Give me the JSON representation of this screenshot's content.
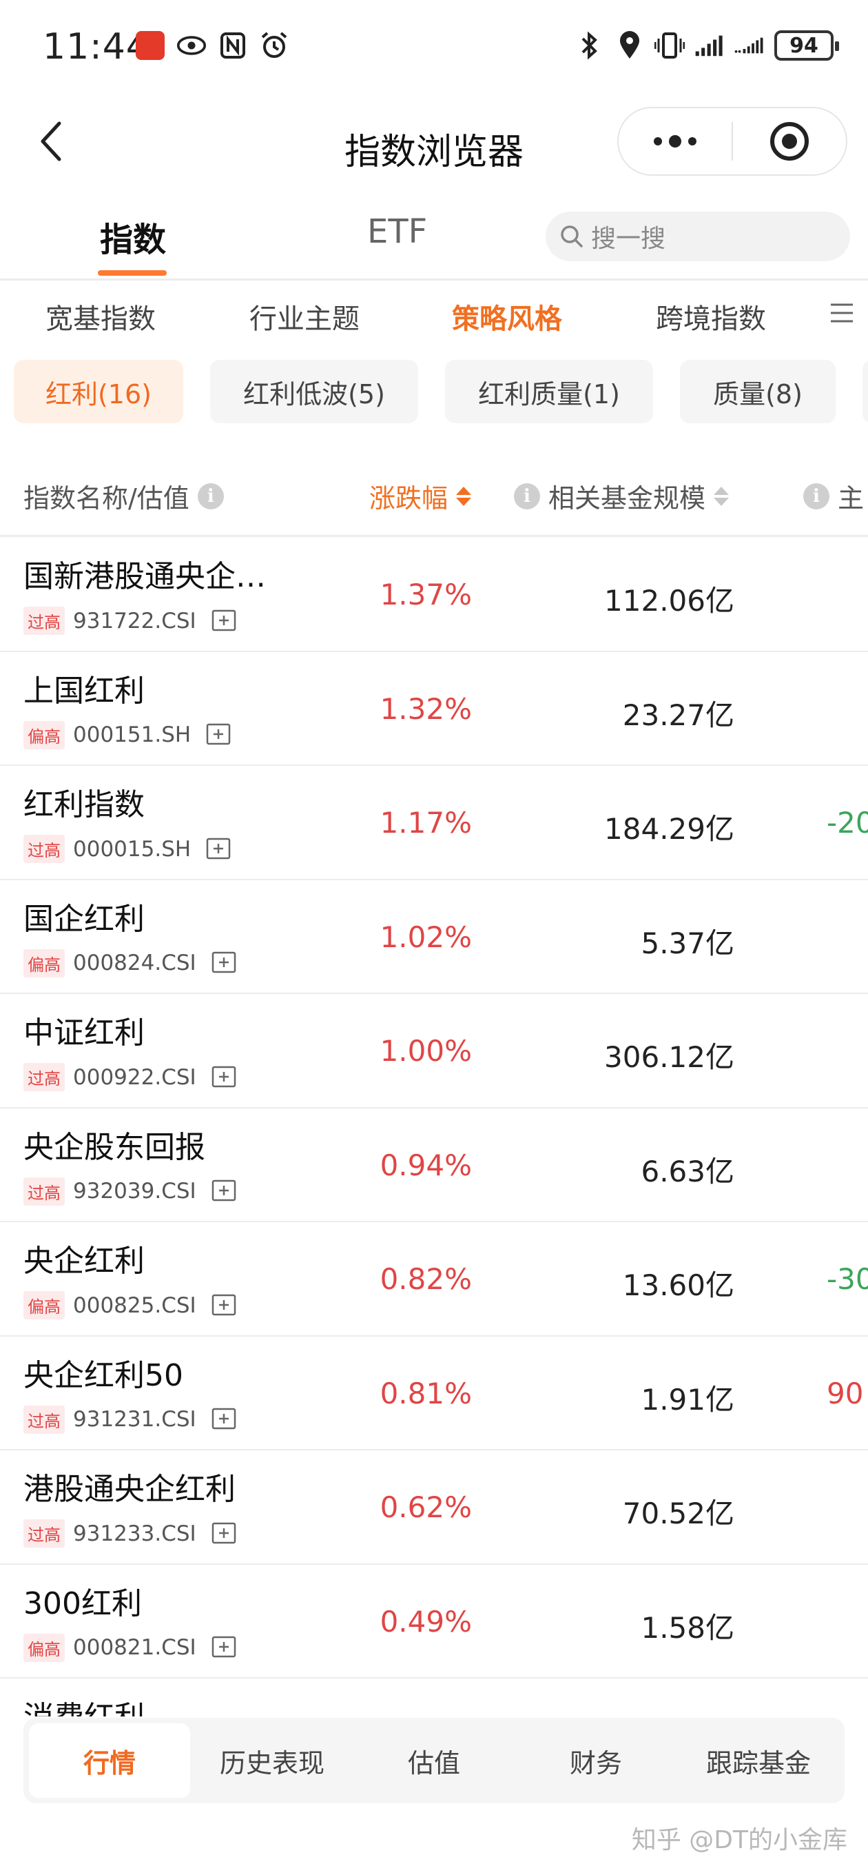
{
  "status_bar": {
    "time": "11:44",
    "battery": "94"
  },
  "title_bar": {
    "title": "指数浏览器"
  },
  "main_tabs": [
    {
      "label": "指数"
    },
    {
      "label": "ETF"
    }
  ],
  "search": {
    "placeholder": "搜一搜"
  },
  "category_tabs": [
    {
      "label": "宽基指数"
    },
    {
      "label": "行业主题"
    },
    {
      "label": "策略风格"
    },
    {
      "label": "跨境指数"
    }
  ],
  "chips": [
    {
      "label": "红利(16)"
    },
    {
      "label": "红利低波(5)"
    },
    {
      "label": "红利质量(1)"
    },
    {
      "label": "质量(8)"
    }
  ],
  "table_header": {
    "name": "指数名称/估值",
    "change": "涨跌幅",
    "scale": "相关基金规模",
    "extra": "主"
  },
  "rows": [
    {
      "name": "国新港股通央企…",
      "tag": "过高",
      "code": "931722.CSI",
      "change": "1.37%",
      "scale": "112.06亿",
      "extra": ""
    },
    {
      "name": "上国红利",
      "tag": "偏高",
      "code": "000151.SH",
      "change": "1.32%",
      "scale": "23.27亿",
      "extra": ""
    },
    {
      "name": "红利指数",
      "tag": "过高",
      "code": "000015.SH",
      "change": "1.17%",
      "scale": "184.29亿",
      "extra": "-20"
    },
    {
      "name": "国企红利",
      "tag": "偏高",
      "code": "000824.CSI",
      "change": "1.02%",
      "scale": "5.37亿",
      "extra": ""
    },
    {
      "name": "中证红利",
      "tag": "过高",
      "code": "000922.CSI",
      "change": "1.00%",
      "scale": "306.12亿",
      "extra": ""
    },
    {
      "name": "央企股东回报",
      "tag": "过高",
      "code": "932039.CSI",
      "change": "0.94%",
      "scale": "6.63亿",
      "extra": ""
    },
    {
      "name": "央企红利",
      "tag": "偏高",
      "code": "000825.CSI",
      "change": "0.82%",
      "scale": "13.60亿",
      "extra": "-30"
    },
    {
      "name": "央企红利50",
      "tag": "过高",
      "code": "931231.CSI",
      "change": "0.81%",
      "scale": "1.91亿",
      "extra": "90"
    },
    {
      "name": "港股通央企红利",
      "tag": "过高",
      "code": "931233.CSI",
      "change": "0.62%",
      "scale": "70.52亿",
      "extra": ""
    },
    {
      "name": "300红利",
      "tag": "偏高",
      "code": "000821.CSI",
      "change": "0.49%",
      "scale": "1.58亿",
      "extra": ""
    },
    {
      "name": "消费红利",
      "tag": "",
      "code": "",
      "change": "",
      "scale": "",
      "extra": ""
    }
  ],
  "bottom_nav": [
    {
      "label": "行情"
    },
    {
      "label": "历史表现"
    },
    {
      "label": "估值"
    },
    {
      "label": "财务"
    },
    {
      "label": "跟踪基金"
    }
  ],
  "watermark": "知乎 @DT的小金库",
  "colors": {
    "accent": "#f07022",
    "up": "#e04545",
    "down": "#3aa55a"
  }
}
